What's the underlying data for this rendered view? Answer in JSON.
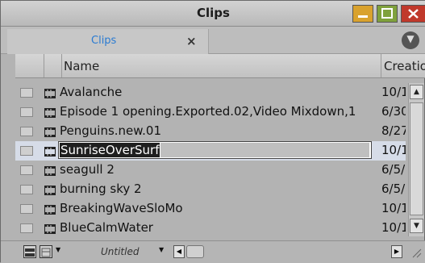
{
  "window": {
    "title": "Clips"
  },
  "tabs": [
    {
      "label": "Clips",
      "close": "×"
    }
  ],
  "header": {
    "name_col": "Name",
    "creation_col": "Creatio"
  },
  "rows": [
    {
      "name": "Avalanche",
      "date": "10/1"
    },
    {
      "name": "Episode 1 opening.Exported.02,Video Mixdown,1",
      "date": "6/30"
    },
    {
      "name": "Penguins.new.01",
      "date": "8/27"
    },
    {
      "name": "SunriseOverSurf",
      "date": "10/1",
      "selected": true,
      "editing": true
    },
    {
      "name": "seagull 2",
      "date": "6/5/"
    },
    {
      "name": "burning sky 2",
      "date": "6/5/"
    },
    {
      "name": "BreakingWaveSloMo",
      "date": "10/1"
    },
    {
      "name": "BlueCalmWater",
      "date": "10/1"
    }
  ],
  "bottom_bar": {
    "view_label": "Untitled"
  },
  "colors": {
    "tab_accent": "#2a7bd2",
    "minimize": "#d9a22e",
    "maximize": "#7fa13c",
    "close": "#c0392b",
    "selection_row": "#d6dce8"
  },
  "icons": [
    "minimize-icon",
    "maximize-icon",
    "close-icon",
    "panel-menu-icon",
    "clip-icon",
    "list-view-icon",
    "frame-view-icon",
    "scroll-up-icon",
    "scroll-down-icon",
    "scroll-left-icon",
    "scroll-right-icon",
    "resize-grip-icon"
  ]
}
